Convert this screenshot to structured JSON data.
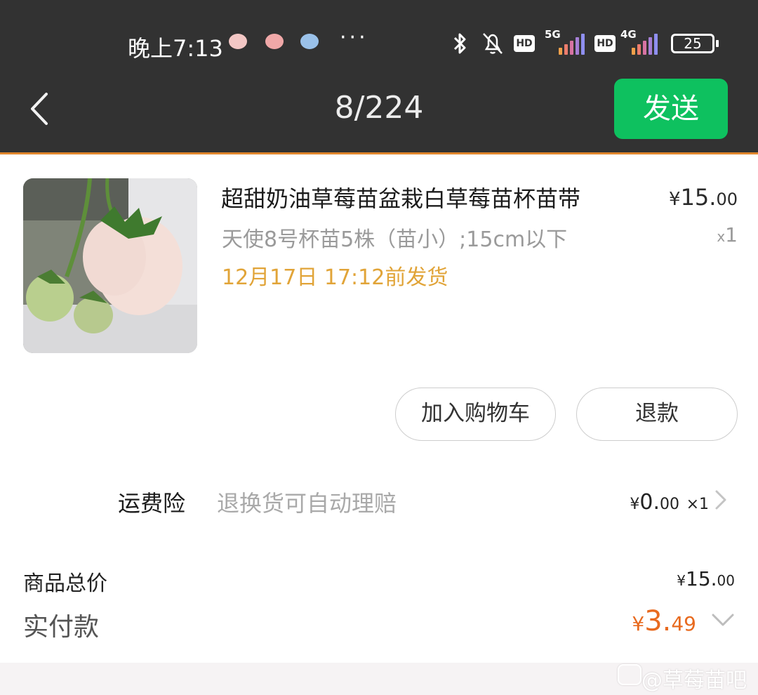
{
  "status_bar": {
    "time": "晚上7:13",
    "more": "···",
    "net1": "5G",
    "net2": "4G",
    "hd": "HD",
    "battery": "25",
    "icons": [
      "app-notification-icon",
      "app-notification-icon",
      "app-notification-icon",
      "bluetooth-icon",
      "bell-muted-icon",
      "signal-bars-icon",
      "battery-icon"
    ]
  },
  "header": {
    "counter": "8/224",
    "send_label": "发送",
    "accent": "#0ec15f"
  },
  "product": {
    "title": "超甜奶油草莓苗盆栽白草莓苗杯苗带",
    "currency": "¥",
    "price_int": "15.",
    "price_dec": "00",
    "sku": "天使8号杯苗5株（苗小）;15cm以下",
    "qty_x": "x",
    "qty": "1",
    "ship_time": "12月17日 17:12前发货",
    "ship_color": "#e1a438"
  },
  "actions": {
    "add_cart": "加入购物车",
    "refund": "退款"
  },
  "insurance": {
    "label": "运费险",
    "desc": "退换货可自动理赔",
    "currency": "¥",
    "price_int": "0.",
    "price_dec": "00",
    "qty": "×1"
  },
  "summary": {
    "subtotal_label": "商品总价",
    "subtotal_currency": "¥",
    "subtotal_int": "15.",
    "subtotal_dec": "00",
    "paid_label": "实付款",
    "paid_currency": "¥",
    "paid_int": "3.",
    "paid_dec": "49",
    "paid_color": "#e86a1f"
  },
  "watermark": "@草莓苗吧"
}
